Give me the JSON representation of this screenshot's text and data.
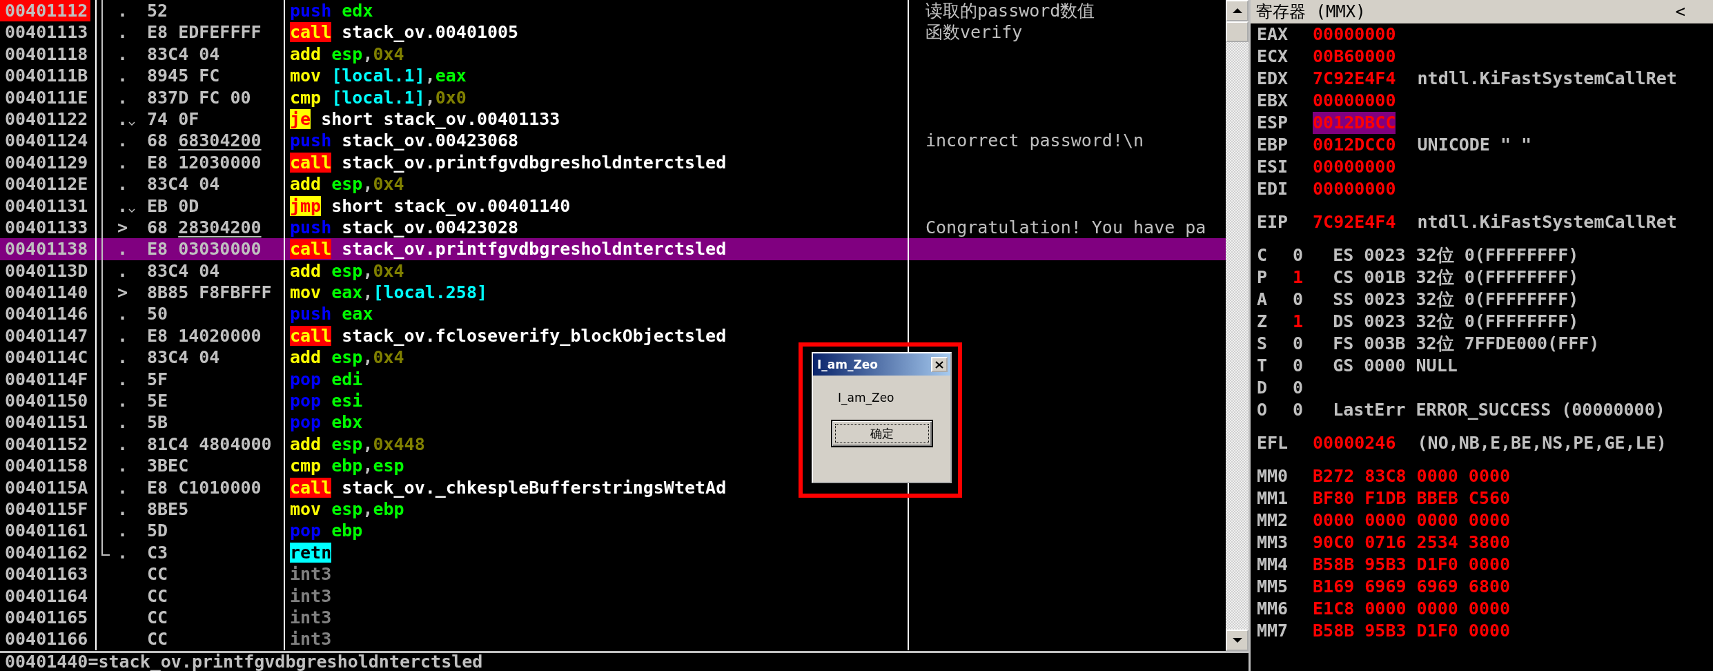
{
  "disassembly": {
    "rows": [
      {
        "address": "00401112",
        "breakpoint": true,
        "selected": false,
        "marker": ".",
        "jump_arrow": false,
        "in_procedure": true,
        "procedure_end": false,
        "bytes": [
          {
            "text": "52",
            "underlined": false
          }
        ],
        "mnemonic": {
          "kind": "stack",
          "text": "push"
        },
        "operands": [
          {
            "kind": "reg",
            "text": "edx"
          }
        ],
        "comment": "读取的password数值"
      },
      {
        "address": "00401113",
        "breakpoint": false,
        "selected": false,
        "marker": ".",
        "jump_arrow": false,
        "in_procedure": true,
        "procedure_end": false,
        "bytes": [
          {
            "text": "E8 EDFEFFFF",
            "underlined": false
          }
        ],
        "mnemonic": {
          "kind": "call",
          "text": "call"
        },
        "operands": [
          {
            "kind": "sym",
            "text": "stack_ov.00401005"
          }
        ],
        "comment": "函数verify"
      },
      {
        "address": "00401118",
        "breakpoint": false,
        "selected": false,
        "marker": ".",
        "jump_arrow": false,
        "in_procedure": true,
        "procedure_end": false,
        "bytes": [
          {
            "text": "83C4 04",
            "underlined": false
          }
        ],
        "mnemonic": {
          "kind": "plain",
          "text": "add"
        },
        "operands": [
          {
            "kind": "reg",
            "text": "esp"
          },
          {
            "kind": "sep",
            "text": ","
          },
          {
            "kind": "imm",
            "text": "0x4"
          }
        ]
      },
      {
        "address": "0040111B",
        "breakpoint": false,
        "selected": false,
        "marker": ".",
        "jump_arrow": false,
        "in_procedure": true,
        "procedure_end": false,
        "bytes": [
          {
            "text": "8945 FC",
            "underlined": false
          }
        ],
        "mnemonic": {
          "kind": "plain",
          "text": "mov"
        },
        "operands": [
          {
            "kind": "mem",
            "text": "[local.1]"
          },
          {
            "kind": "sep",
            "text": ","
          },
          {
            "kind": "reg",
            "text": "eax"
          }
        ]
      },
      {
        "address": "0040111E",
        "breakpoint": false,
        "selected": false,
        "marker": ".",
        "jump_arrow": false,
        "in_procedure": true,
        "procedure_end": false,
        "bytes": [
          {
            "text": "837D FC 00",
            "underlined": false
          }
        ],
        "mnemonic": {
          "kind": "plain",
          "text": "cmp"
        },
        "operands": [
          {
            "kind": "mem",
            "text": "[local.1]"
          },
          {
            "kind": "sep",
            "text": ","
          },
          {
            "kind": "imm",
            "text": "0x0"
          }
        ]
      },
      {
        "address": "00401122",
        "breakpoint": false,
        "selected": false,
        "marker": ".",
        "jump_arrow": true,
        "in_procedure": true,
        "procedure_end": false,
        "bytes": [
          {
            "text": "74 0F",
            "underlined": false
          }
        ],
        "mnemonic": {
          "kind": "jump",
          "text": "je"
        },
        "operands": [
          {
            "kind": "sym",
            "text": "short stack_ov.00401133"
          }
        ]
      },
      {
        "address": "00401124",
        "breakpoint": false,
        "selected": false,
        "marker": ".",
        "jump_arrow": false,
        "in_procedure": true,
        "procedure_end": false,
        "bytes": [
          {
            "text": "68",
            "underlined": false
          },
          {
            "text": "68304200",
            "underlined": true
          }
        ],
        "mnemonic": {
          "kind": "stack",
          "text": "push"
        },
        "operands": [
          {
            "kind": "sym",
            "text": "stack_ov.00423068"
          }
        ],
        "comment": "incorrect password!\\n"
      },
      {
        "address": "00401129",
        "breakpoint": false,
        "selected": false,
        "marker": ".",
        "jump_arrow": false,
        "in_procedure": true,
        "procedure_end": false,
        "bytes": [
          {
            "text": "E8 12030000",
            "underlined": false
          }
        ],
        "mnemonic": {
          "kind": "call",
          "text": "call"
        },
        "operands": [
          {
            "kind": "sym",
            "text": "stack_ov.printfgvdbgresholdnterctsled"
          }
        ]
      },
      {
        "address": "0040112E",
        "breakpoint": false,
        "selected": false,
        "marker": ".",
        "jump_arrow": false,
        "in_procedure": true,
        "procedure_end": false,
        "bytes": [
          {
            "text": "83C4 04",
            "underlined": false
          }
        ],
        "mnemonic": {
          "kind": "plain",
          "text": "add"
        },
        "operands": [
          {
            "kind": "reg",
            "text": "esp"
          },
          {
            "kind": "sep",
            "text": ","
          },
          {
            "kind": "imm",
            "text": "0x4"
          }
        ]
      },
      {
        "address": "00401131",
        "breakpoint": false,
        "selected": false,
        "marker": ".",
        "jump_arrow": true,
        "in_procedure": true,
        "procedure_end": false,
        "bytes": [
          {
            "text": "EB 0D",
            "underlined": false
          }
        ],
        "mnemonic": {
          "kind": "jump",
          "text": "jmp"
        },
        "operands": [
          {
            "kind": "sym",
            "text": "short stack_ov.00401140"
          }
        ]
      },
      {
        "address": "00401133",
        "breakpoint": false,
        "selected": false,
        "marker": ">",
        "jump_arrow": false,
        "in_procedure": true,
        "procedure_end": false,
        "bytes": [
          {
            "text": "68",
            "underlined": false
          },
          {
            "text": "28304200",
            "underlined": true
          }
        ],
        "mnemonic": {
          "kind": "stack",
          "text": "push"
        },
        "operands": [
          {
            "kind": "sym",
            "text": "stack_ov.00423028"
          }
        ],
        "comment": "Congratulation! You have pa"
      },
      {
        "address": "00401138",
        "breakpoint": false,
        "selected": true,
        "marker": ".",
        "jump_arrow": false,
        "in_procedure": true,
        "procedure_end": false,
        "bytes": [
          {
            "text": "E8 03030000",
            "underlined": false
          }
        ],
        "mnemonic": {
          "kind": "call",
          "text": "call"
        },
        "operands": [
          {
            "kind": "sym",
            "text": "stack_ov.printfgvdbgresholdnterctsled"
          }
        ]
      },
      {
        "address": "0040113D",
        "breakpoint": false,
        "selected": false,
        "marker": ".",
        "jump_arrow": false,
        "in_procedure": true,
        "procedure_end": false,
        "bytes": [
          {
            "text": "83C4 04",
            "underlined": false
          }
        ],
        "mnemonic": {
          "kind": "plain",
          "text": "add"
        },
        "operands": [
          {
            "kind": "reg",
            "text": "esp"
          },
          {
            "kind": "sep",
            "text": ","
          },
          {
            "kind": "imm",
            "text": "0x4"
          }
        ]
      },
      {
        "address": "00401140",
        "breakpoint": false,
        "selected": false,
        "marker": ">",
        "jump_arrow": false,
        "in_procedure": true,
        "procedure_end": false,
        "bytes": [
          {
            "text": "8B85 F8FBFFF",
            "underlined": false
          }
        ],
        "mnemonic": {
          "kind": "plain",
          "text": "mov"
        },
        "operands": [
          {
            "kind": "reg",
            "text": "eax"
          },
          {
            "kind": "sep",
            "text": ","
          },
          {
            "kind": "mem",
            "text": "[local.258]"
          }
        ]
      },
      {
        "address": "00401146",
        "breakpoint": false,
        "selected": false,
        "marker": ".",
        "jump_arrow": false,
        "in_procedure": true,
        "procedure_end": false,
        "bytes": [
          {
            "text": "50",
            "underlined": false
          }
        ],
        "mnemonic": {
          "kind": "stack",
          "text": "push"
        },
        "operands": [
          {
            "kind": "reg",
            "text": "eax"
          }
        ]
      },
      {
        "address": "00401147",
        "breakpoint": false,
        "selected": false,
        "marker": ".",
        "jump_arrow": false,
        "in_procedure": true,
        "procedure_end": false,
        "bytes": [
          {
            "text": "E8 14020000",
            "underlined": false
          }
        ],
        "mnemonic": {
          "kind": "call",
          "text": "call"
        },
        "operands": [
          {
            "kind": "sym",
            "text": "stack_ov.fcloseverify_blockObjectsled"
          }
        ]
      },
      {
        "address": "0040114C",
        "breakpoint": false,
        "selected": false,
        "marker": ".",
        "jump_arrow": false,
        "in_procedure": true,
        "procedure_end": false,
        "bytes": [
          {
            "text": "83C4 04",
            "underlined": false
          }
        ],
        "mnemonic": {
          "kind": "plain",
          "text": "add"
        },
        "operands": [
          {
            "kind": "reg",
            "text": "esp"
          },
          {
            "kind": "sep",
            "text": ","
          },
          {
            "kind": "imm",
            "text": "0x4"
          }
        ]
      },
      {
        "address": "0040114F",
        "breakpoint": false,
        "selected": false,
        "marker": ".",
        "jump_arrow": false,
        "in_procedure": true,
        "procedure_end": false,
        "bytes": [
          {
            "text": "5F",
            "underlined": false
          }
        ],
        "mnemonic": {
          "kind": "stack",
          "text": "pop"
        },
        "operands": [
          {
            "kind": "reg",
            "text": "edi"
          }
        ]
      },
      {
        "address": "00401150",
        "breakpoint": false,
        "selected": false,
        "marker": ".",
        "jump_arrow": false,
        "in_procedure": true,
        "procedure_end": false,
        "bytes": [
          {
            "text": "5E",
            "underlined": false
          }
        ],
        "mnemonic": {
          "kind": "stack",
          "text": "pop"
        },
        "operands": [
          {
            "kind": "reg",
            "text": "esi"
          }
        ]
      },
      {
        "address": "00401151",
        "breakpoint": false,
        "selected": false,
        "marker": ".",
        "jump_arrow": false,
        "in_procedure": true,
        "procedure_end": false,
        "bytes": [
          {
            "text": "5B",
            "underlined": false
          }
        ],
        "mnemonic": {
          "kind": "stack",
          "text": "pop"
        },
        "operands": [
          {
            "kind": "reg",
            "text": "ebx"
          }
        ]
      },
      {
        "address": "00401152",
        "breakpoint": false,
        "selected": false,
        "marker": ".",
        "jump_arrow": false,
        "in_procedure": true,
        "procedure_end": false,
        "bytes": [
          {
            "text": "81C4 4804000",
            "underlined": false
          }
        ],
        "mnemonic": {
          "kind": "plain",
          "text": "add"
        },
        "operands": [
          {
            "kind": "reg",
            "text": "esp"
          },
          {
            "kind": "sep",
            "text": ","
          },
          {
            "kind": "imm",
            "text": "0x448"
          }
        ]
      },
      {
        "address": "00401158",
        "breakpoint": false,
        "selected": false,
        "marker": ".",
        "jump_arrow": false,
        "in_procedure": true,
        "procedure_end": false,
        "bytes": [
          {
            "text": "3BEC",
            "underlined": false
          }
        ],
        "mnemonic": {
          "kind": "plain",
          "text": "cmp"
        },
        "operands": [
          {
            "kind": "reg",
            "text": "ebp"
          },
          {
            "kind": "sep",
            "text": ","
          },
          {
            "kind": "reg",
            "text": "esp"
          }
        ]
      },
      {
        "address": "0040115A",
        "breakpoint": false,
        "selected": false,
        "marker": ".",
        "jump_arrow": false,
        "in_procedure": true,
        "procedure_end": false,
        "bytes": [
          {
            "text": "E8 C1010000",
            "underlined": false
          }
        ],
        "mnemonic": {
          "kind": "call",
          "text": "call"
        },
        "operands": [
          {
            "kind": "sym",
            "text": "stack_ov._chkespleBufferstringsWtetAd"
          }
        ]
      },
      {
        "address": "0040115F",
        "breakpoint": false,
        "selected": false,
        "marker": ".",
        "jump_arrow": false,
        "in_procedure": true,
        "procedure_end": false,
        "bytes": [
          {
            "text": "8BE5",
            "underlined": false
          }
        ],
        "mnemonic": {
          "kind": "plain",
          "text": "mov"
        },
        "operands": [
          {
            "kind": "reg",
            "text": "esp"
          },
          {
            "kind": "sep",
            "text": ","
          },
          {
            "kind": "reg",
            "text": "ebp"
          }
        ]
      },
      {
        "address": "00401161",
        "breakpoint": false,
        "selected": false,
        "marker": ".",
        "jump_arrow": false,
        "in_procedure": true,
        "procedure_end": false,
        "bytes": [
          {
            "text": "5D",
            "underlined": false
          }
        ],
        "mnemonic": {
          "kind": "stack",
          "text": "pop"
        },
        "operands": [
          {
            "kind": "reg",
            "text": "ebp"
          }
        ]
      },
      {
        "address": "00401162",
        "breakpoint": false,
        "selected": false,
        "marker": ".",
        "jump_arrow": false,
        "in_procedure": true,
        "procedure_end": true,
        "bytes": [
          {
            "text": "C3",
            "underlined": false
          }
        ],
        "mnemonic": {
          "kind": "return",
          "text": "retn"
        },
        "operands": []
      },
      {
        "address": "00401163",
        "breakpoint": false,
        "selected": false,
        "jump_arrow": false,
        "in_procedure": false,
        "procedure_end": false,
        "bytes": [
          {
            "text": "CC",
            "underlined": false
          }
        ],
        "mnemonic": {
          "kind": "filler",
          "text": "int3"
        },
        "operands": []
      },
      {
        "address": "00401164",
        "breakpoint": false,
        "selected": false,
        "jump_arrow": false,
        "in_procedure": false,
        "procedure_end": false,
        "bytes": [
          {
            "text": "CC",
            "underlined": false
          }
        ],
        "mnemonic": {
          "kind": "filler",
          "text": "int3"
        },
        "operands": []
      },
      {
        "address": "00401165",
        "breakpoint": false,
        "selected": false,
        "jump_arrow": false,
        "in_procedure": false,
        "procedure_end": false,
        "bytes": [
          {
            "text": "CC",
            "underlined": false
          }
        ],
        "mnemonic": {
          "kind": "filler",
          "text": "int3"
        },
        "operands": []
      },
      {
        "address": "00401166",
        "breakpoint": false,
        "selected": false,
        "jump_arrow": false,
        "in_procedure": false,
        "procedure_end": false,
        "bytes": [
          {
            "text": "CC",
            "underlined": false
          }
        ],
        "mnemonic": {
          "kind": "filler",
          "text": "int3"
        },
        "operands": []
      }
    ]
  },
  "status_bar": "00401440=stack_ov.printfgvdbgresholdnterctsled",
  "registers": {
    "title": "寄存器 (MMX)",
    "collapse": "<",
    "groups": [
      {
        "rows": [
          {
            "kind": "reg",
            "name": "EAX",
            "value": "00000000",
            "changed": true,
            "selected": false
          },
          {
            "kind": "reg",
            "name": "ECX",
            "value": "00B60000",
            "changed": true,
            "selected": false
          },
          {
            "kind": "reg",
            "name": "EDX",
            "value": "7C92E4F4",
            "changed": true,
            "selected": false,
            "comment": "ntdll.KiFastSystemCallRet"
          },
          {
            "kind": "reg",
            "name": "EBX",
            "value": "00000000",
            "changed": true,
            "selected": false
          },
          {
            "kind": "reg",
            "name": "ESP",
            "value": "0012DBCC",
            "changed": true,
            "selected": true
          },
          {
            "kind": "reg",
            "name": "EBP",
            "value": "0012DCC0",
            "changed": true,
            "selected": false,
            "comment": "UNICODE \" \""
          },
          {
            "kind": "reg",
            "name": "ESI",
            "value": "00000000",
            "changed": true,
            "selected": false
          },
          {
            "kind": "reg",
            "name": "EDI",
            "value": "00000000",
            "changed": true,
            "selected": false
          }
        ]
      },
      {
        "rows": [
          {
            "kind": "reg",
            "name": "EIP",
            "value": "7C92E4F4",
            "changed": true,
            "selected": false,
            "comment": "ntdll.KiFastSystemCallRet"
          }
        ]
      },
      {
        "rows": [
          {
            "kind": "flag",
            "name": "C",
            "value": "0",
            "changed": false,
            "detail": "ES 0023 32位 0(FFFFFFFF)"
          },
          {
            "kind": "flag",
            "name": "P",
            "value": "1",
            "changed": true,
            "detail": "CS 001B 32位 0(FFFFFFFF)"
          },
          {
            "kind": "flag",
            "name": "A",
            "value": "0",
            "changed": false,
            "detail": "SS 0023 32位 0(FFFFFFFF)"
          },
          {
            "kind": "flag",
            "name": "Z",
            "value": "1",
            "changed": true,
            "detail": "DS 0023 32位 0(FFFFFFFF)"
          },
          {
            "kind": "flag",
            "name": "S",
            "value": "0",
            "changed": false,
            "detail": "FS 003B 32位 7FFDE000(FFF)"
          },
          {
            "kind": "flag",
            "name": "T",
            "value": "0",
            "changed": false,
            "detail": "GS 0000 NULL"
          },
          {
            "kind": "flag",
            "name": "D",
            "value": "0",
            "changed": false
          },
          {
            "kind": "flag",
            "name": "O",
            "value": "0",
            "changed": false,
            "detail": "LastErr ERROR_SUCCESS (00000000)"
          }
        ]
      },
      {
        "rows": [
          {
            "kind": "reg",
            "name": "EFL",
            "value": "00000246",
            "changed": true,
            "selected": false,
            "comment": "(NO,NB,E,BE,NS,PE,GE,LE)"
          }
        ]
      },
      {
        "rows": [
          {
            "kind": "reg",
            "name": "MM0",
            "value": "B272 83C8 0000 0000",
            "changed": true,
            "selected": false
          },
          {
            "kind": "reg",
            "name": "MM1",
            "value": "BF80 F1DB BBEB C560",
            "changed": true,
            "selected": false
          },
          {
            "kind": "reg",
            "name": "MM2",
            "value": "0000 0000 0000 0000",
            "changed": true,
            "selected": false
          },
          {
            "kind": "reg",
            "name": "MM3",
            "value": "90C0 0716 2534 3800",
            "changed": true,
            "selected": false
          },
          {
            "kind": "reg",
            "name": "MM4",
            "value": "B58B 95B3 D1F0 0000",
            "changed": true,
            "selected": false
          },
          {
            "kind": "reg",
            "name": "MM5",
            "value": "B169 6969 6969 6800",
            "changed": true,
            "selected": false
          },
          {
            "kind": "reg",
            "name": "MM6",
            "value": "E1C8 0000 0000 0000",
            "changed": true,
            "selected": false
          },
          {
            "kind": "reg",
            "name": "MM7",
            "value": "B58B 95B3 D1F0 0000",
            "changed": true,
            "selected": false
          }
        ]
      }
    ]
  },
  "dialog": {
    "title": "I_am_Zeo",
    "message": "I_am_Zeo",
    "button": "确定"
  }
}
